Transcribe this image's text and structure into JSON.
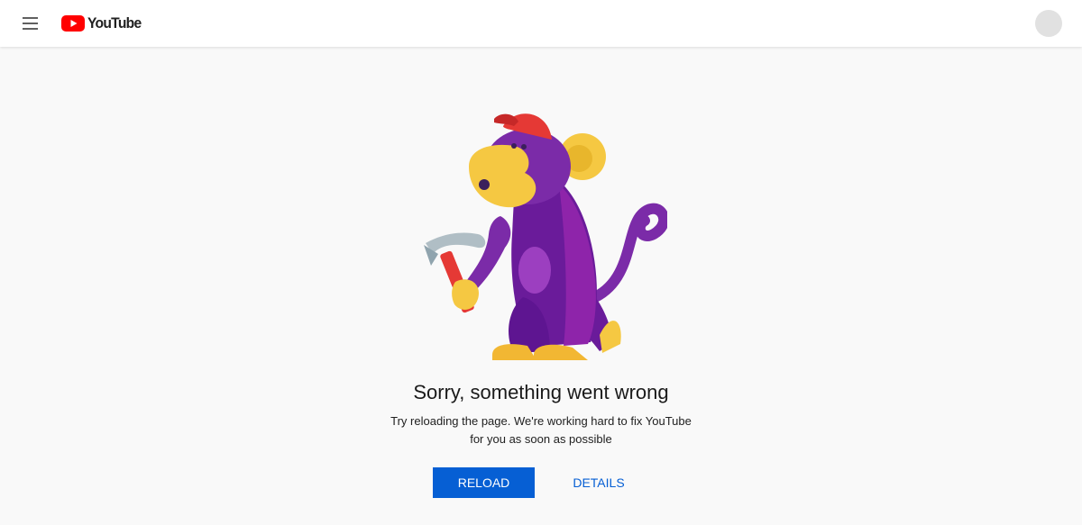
{
  "header": {
    "menu_icon": "hamburger-menu-icon",
    "logo_text": "YouTube",
    "logo_icon": "youtube-play-icon",
    "avatar_icon": "user-avatar"
  },
  "error": {
    "illustration": "monkey-with-hammer",
    "title": "Sorry, something went wrong",
    "message_line1": "Try reloading the page. We're working hard to fix YouTube",
    "message_line2": "for you as soon as possible"
  },
  "actions": {
    "reload_label": "RELOAD",
    "details_label": "DETAILS"
  },
  "colors": {
    "brand_red": "#ff0000",
    "primary_blue": "#065fd4",
    "background": "#f9f9f9",
    "monkey_purple": "#7b2ba8",
    "monkey_yellow": "#f5c842"
  }
}
